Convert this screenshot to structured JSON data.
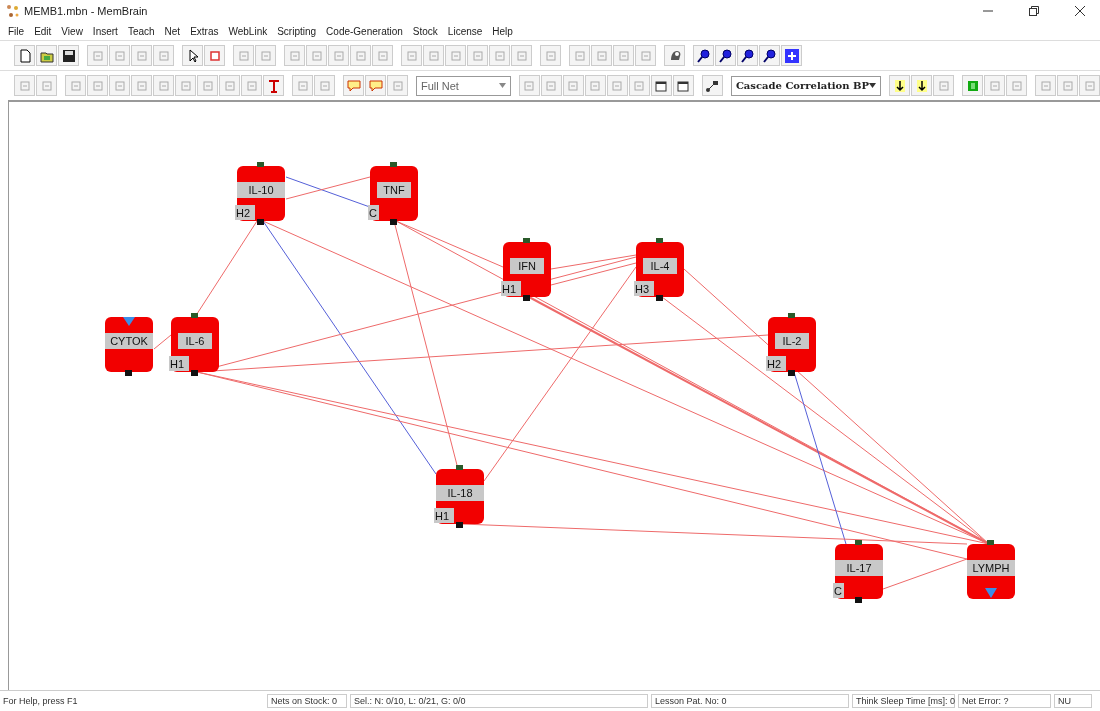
{
  "window": {
    "title": "MEMB1.mbn - MemBrain"
  },
  "menu": [
    "File",
    "Edit",
    "View",
    "Insert",
    "Teach",
    "Net",
    "Extras",
    "WebLink",
    "Scripting",
    "Code-Generation",
    "Stock",
    "License",
    "Help"
  ],
  "toolbar": {
    "view_select": "Full Net",
    "algorithm_select": "Cascade Correlation BP"
  },
  "neurons": [
    {
      "label": "CYTOK",
      "kind": "input"
    },
    {
      "label": "IL-6",
      "tag": "H1",
      "kind": "hidden"
    },
    {
      "label": "IL-10",
      "tag": "H2",
      "kind": "hidden"
    },
    {
      "label": "TNF",
      "tag": "C",
      "kind": "hidden"
    },
    {
      "label": "IFN",
      "tag": "H1",
      "kind": "hidden"
    },
    {
      "label": "IL-4",
      "tag": "H3",
      "kind": "hidden"
    },
    {
      "label": "IL-2",
      "tag": "H2",
      "kind": "hidden"
    },
    {
      "label": "IL-18",
      "tag": "H1",
      "kind": "hidden"
    },
    {
      "label": "IL-17",
      "tag": "C",
      "kind": "hidden"
    },
    {
      "label": "LYMPH",
      "kind": "output"
    }
  ],
  "status_bar": [
    "For Help, press F1",
    "Nets on Stock: 0",
    "Sel.: N: 0/10, L: 0/21, G: 0/0",
    "Lesson Pat. No: 0",
    "Think Sleep Time [ms]: 0",
    "Net Error: ?",
    "NU"
  ]
}
